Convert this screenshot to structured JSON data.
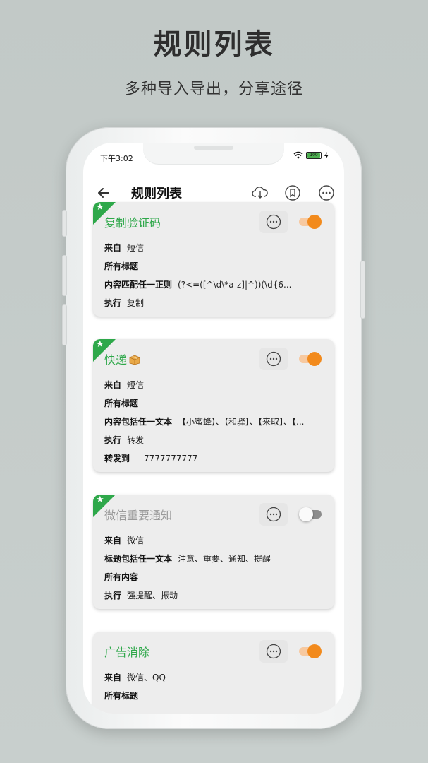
{
  "promo": {
    "title": "规则列表",
    "subtitle": "多种导入导出，分享途径"
  },
  "status_bar": {
    "time": "下午3:02",
    "battery": "100"
  },
  "app_bar": {
    "title": "规则列表",
    "icons": [
      "back-arrow-icon",
      "cloud-download-icon",
      "bookmark-icon",
      "more-icon"
    ]
  },
  "colors": {
    "accent_green": "#2ea84a",
    "toggle_orange": "#f28a1c",
    "card_bg": "#ededed"
  },
  "rules": [
    {
      "title": "复制验证码",
      "enabled": true,
      "starred": true,
      "rows": [
        {
          "k": "来自",
          "v": "短信"
        },
        {
          "k": "所有标题",
          "v": ""
        },
        {
          "k": "内容匹配任一正则",
          "v": "(?<=([^\\d\\*a-z]|^))(\\d{6..."
        },
        {
          "k": "执行",
          "v": "复制"
        }
      ]
    },
    {
      "title": "快递",
      "title_icon": "package-icon",
      "enabled": true,
      "starred": true,
      "rows": [
        {
          "k": "来自",
          "v": "短信"
        },
        {
          "k": "所有标题",
          "v": ""
        },
        {
          "k": "内容包括任一文本",
          "v": "【小蜜蜂】、【和驿】、【来取】、【..."
        },
        {
          "k": "执行",
          "v": "转发"
        },
        {
          "k": "转发到",
          "v": "7777777777"
        }
      ]
    },
    {
      "title": "微信重要通知",
      "enabled": false,
      "starred": true,
      "rows": [
        {
          "k": "来自",
          "v": "微信"
        },
        {
          "k": "标题包括任一文本",
          "v": "注意、重要、通知、提醒"
        },
        {
          "k": "所有内容",
          "v": ""
        },
        {
          "k": "执行",
          "v": "强提醒、振动"
        }
      ]
    },
    {
      "title": "广告消除",
      "enabled": true,
      "starred": false,
      "rows": [
        {
          "k": "来自",
          "v": "微信、QQ"
        },
        {
          "k": "所有标题",
          "v": ""
        }
      ]
    }
  ]
}
